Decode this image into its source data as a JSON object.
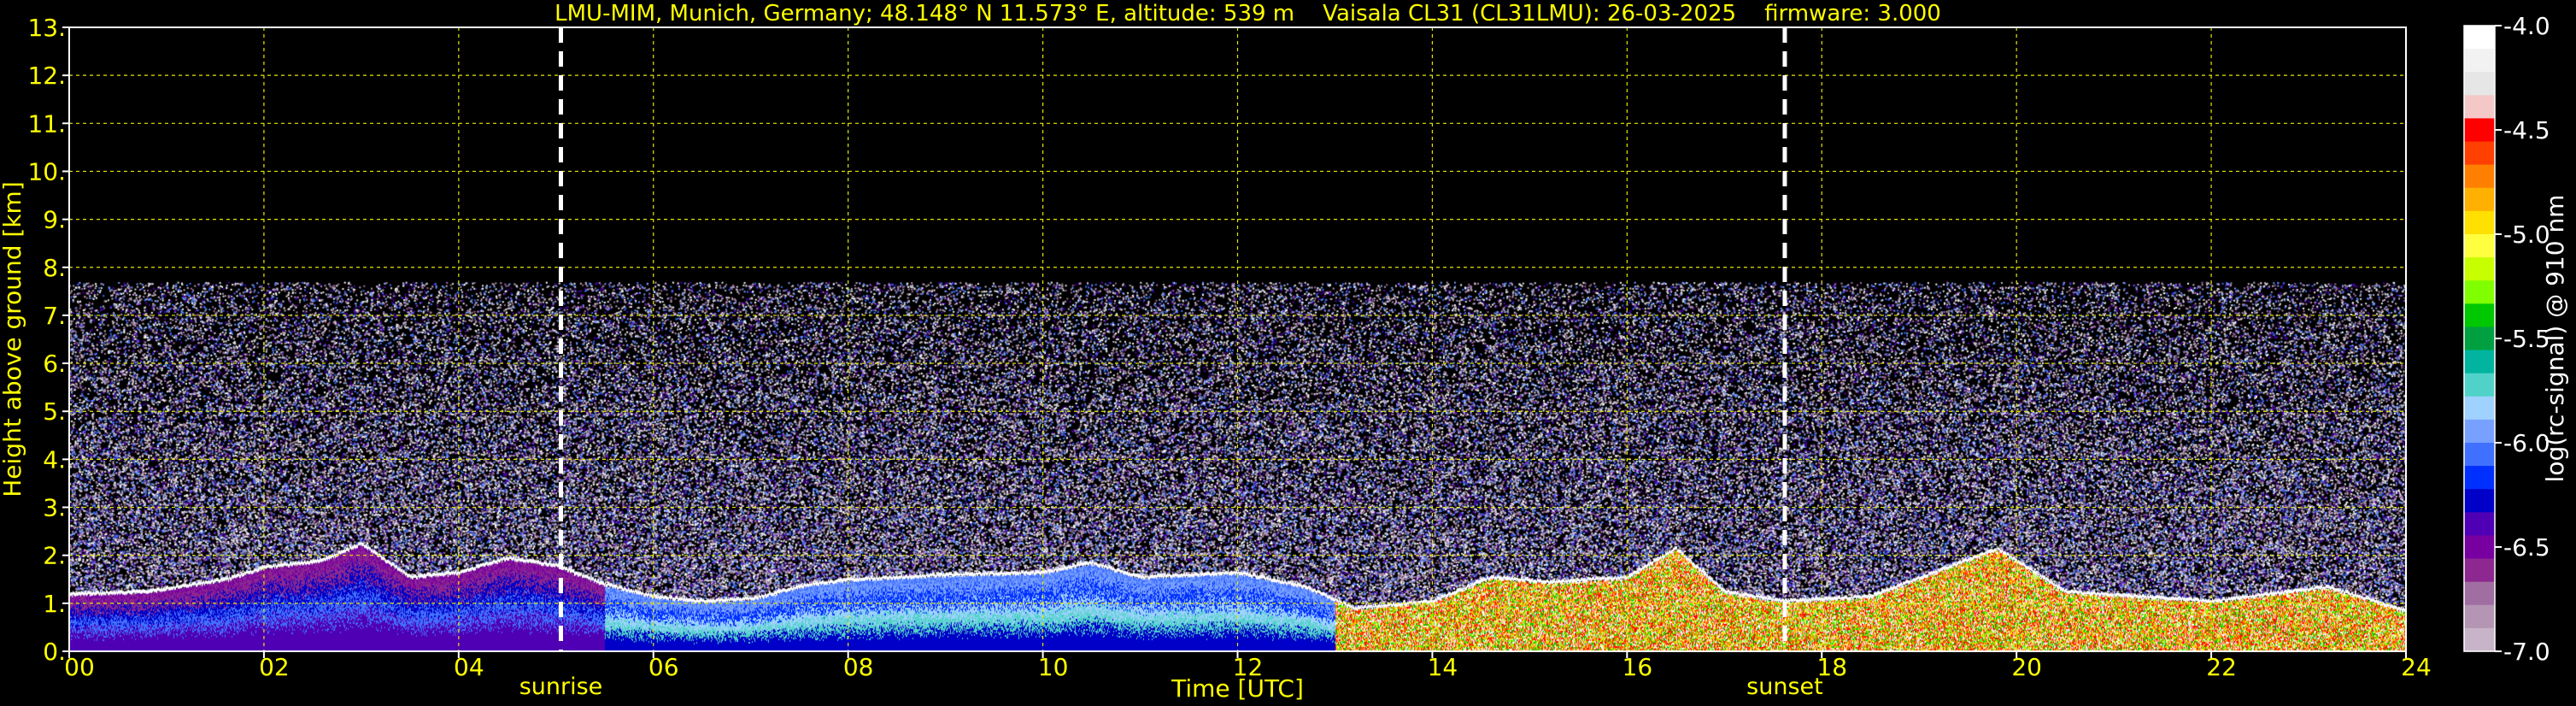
{
  "chart_data": {
    "type": "heatmap",
    "title": "LMU-MIM, Munich, Germany; 48.148° N 11.573° E, altitude: 539 m    Vaisala CL31 (CL31LMU): 26-03-2025    firmware: 3.000",
    "xlabel": "Time [UTC]",
    "ylabel": "Height above ground [km]",
    "xlim": [
      0,
      24
    ],
    "ylim": [
      0,
      13
    ],
    "x_ticks": [
      "00",
      "02",
      "04",
      "06",
      "08",
      "10",
      "12",
      "14",
      "16",
      "18",
      "20",
      "22",
      "24"
    ],
    "y_ticks": [
      "0.",
      "1.",
      "2.",
      "3.",
      "4.",
      "5.",
      "6.",
      "7.",
      "8.",
      "9.",
      "10.",
      "11.",
      "12.",
      "13."
    ],
    "grid": true,
    "events": [
      {
        "label": "sunrise",
        "x": 5.05
      },
      {
        "label": "sunset",
        "x": 17.62
      }
    ],
    "noise_top_km": 7.7,
    "colorbar": {
      "label": "log(rc-signal) @ 910 nm",
      "ticks": [
        "-4.0",
        "-4.5",
        "-5.0",
        "-5.5",
        "-6.0",
        "-6.5",
        "-7.0"
      ],
      "range": [
        -7.0,
        -4.0
      ],
      "colors": [
        "#ffffff",
        "#f2f2f2",
        "#e6e6e6",
        "#f5c8c8",
        "#ff0000",
        "#ff4000",
        "#ff8000",
        "#ffb000",
        "#ffe000",
        "#ffff40",
        "#c8ff00",
        "#80ff00",
        "#00c800",
        "#00a040",
        "#00b4a0",
        "#50d2c8",
        "#a0d2ff",
        "#78a0ff",
        "#4070ff",
        "#0030ff",
        "#0000c8",
        "#5000b4",
        "#7800a0",
        "#8c2890",
        "#a06ea0",
        "#b496b4",
        "#c8b4c8"
      ]
    },
    "layer_top_km": [
      {
        "x": 0.0,
        "y": 1.15
      },
      {
        "x": 0.8,
        "y": 1.2
      },
      {
        "x": 1.6,
        "y": 1.45
      },
      {
        "x": 2.0,
        "y": 1.7
      },
      {
        "x": 2.6,
        "y": 1.85
      },
      {
        "x": 3.0,
        "y": 2.2
      },
      {
        "x": 3.5,
        "y": 1.5
      },
      {
        "x": 4.0,
        "y": 1.6
      },
      {
        "x": 4.5,
        "y": 1.9
      },
      {
        "x": 5.0,
        "y": 1.75
      },
      {
        "x": 5.5,
        "y": 1.35
      },
      {
        "x": 6.0,
        "y": 1.1
      },
      {
        "x": 6.5,
        "y": 1.0
      },
      {
        "x": 7.0,
        "y": 1.05
      },
      {
        "x": 7.6,
        "y": 1.35
      },
      {
        "x": 8.0,
        "y": 1.45
      },
      {
        "x": 9.0,
        "y": 1.55
      },
      {
        "x": 10.0,
        "y": 1.6
      },
      {
        "x": 10.5,
        "y": 1.8
      },
      {
        "x": 11.0,
        "y": 1.5
      },
      {
        "x": 12.0,
        "y": 1.6
      },
      {
        "x": 12.7,
        "y": 1.3
      },
      {
        "x": 13.2,
        "y": 0.85
      },
      {
        "x": 14.0,
        "y": 1.0
      },
      {
        "x": 14.6,
        "y": 1.5
      },
      {
        "x": 15.2,
        "y": 1.4
      },
      {
        "x": 16.0,
        "y": 1.5
      },
      {
        "x": 16.5,
        "y": 2.1
      },
      {
        "x": 17.0,
        "y": 1.2
      },
      {
        "x": 17.6,
        "y": 1.0
      },
      {
        "x": 18.5,
        "y": 1.1
      },
      {
        "x": 19.8,
        "y": 2.1
      },
      {
        "x": 20.5,
        "y": 1.2
      },
      {
        "x": 22.0,
        "y": 1.0
      },
      {
        "x": 23.2,
        "y": 1.3
      },
      {
        "x": 24.0,
        "y": 0.8
      }
    ]
  }
}
